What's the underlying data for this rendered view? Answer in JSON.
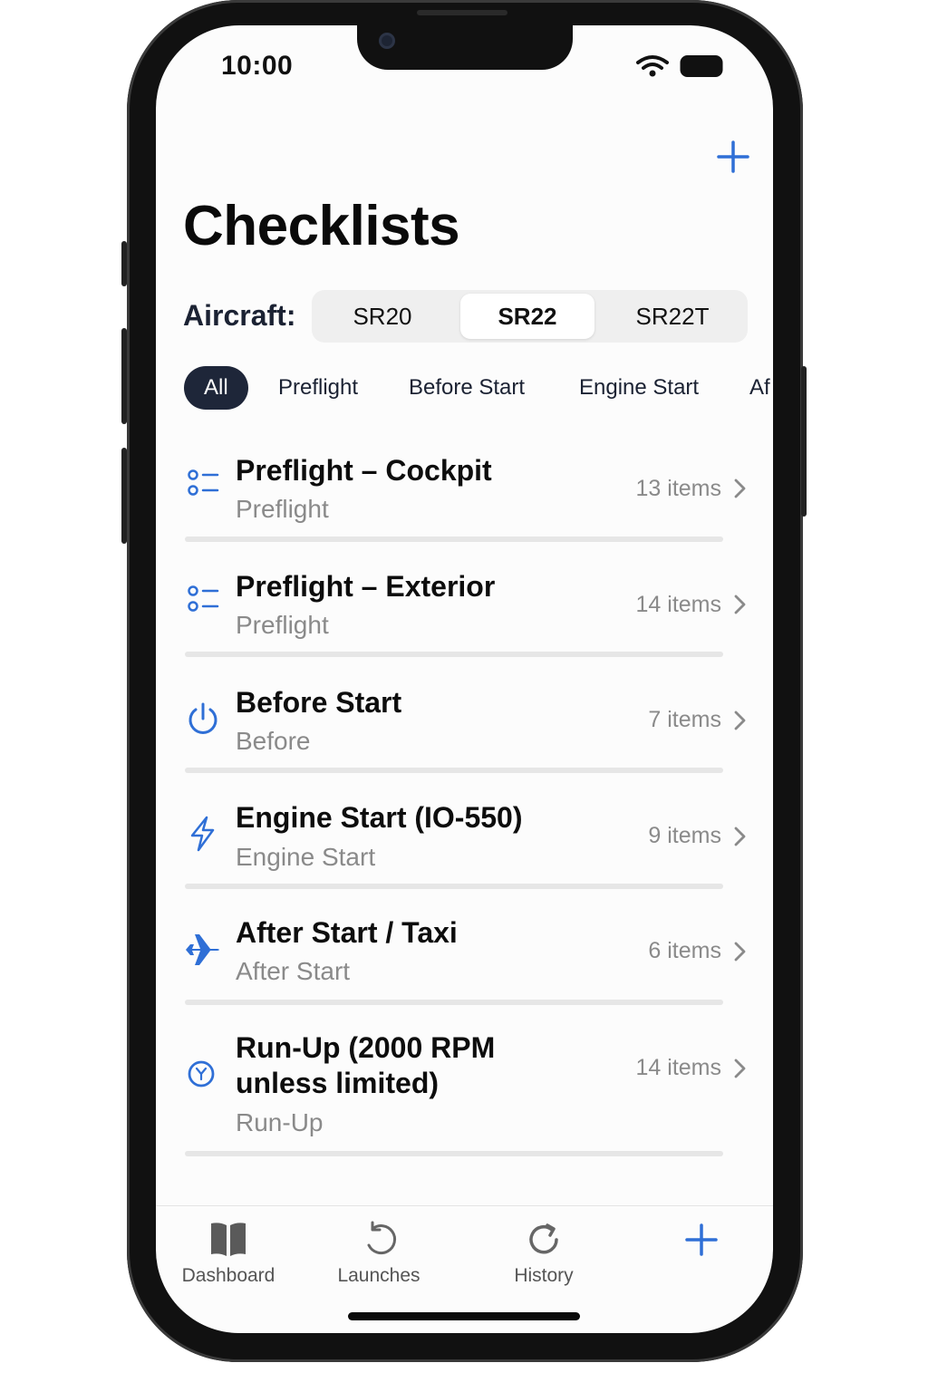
{
  "status": {
    "time": "10:00"
  },
  "header": {
    "title": "Checklists",
    "add_icon": "plus-icon"
  },
  "aircraft": {
    "label": "Aircraft:",
    "options": [
      "SR20",
      "SR22",
      "SR22T"
    ],
    "selected": "SR22"
  },
  "filters": {
    "chips": [
      "All",
      "Preflight",
      "Before Start",
      "Engine Start",
      "Af"
    ],
    "selected": "All"
  },
  "checklists": [
    {
      "title": "Preflight – Cockpit",
      "category": "Preflight",
      "count": "13 items",
      "icon": "checklist-icon"
    },
    {
      "title": "Preflight – Exterior",
      "category": "Preflight",
      "count": "14 items",
      "icon": "checklist-icon"
    },
    {
      "title": "Before Start",
      "category": "Before",
      "count": "7 items",
      "icon": "power-icon"
    },
    {
      "title": "Engine Start (IO-550)",
      "category": "Engine Start",
      "count": "9 items",
      "icon": "bolt-icon"
    },
    {
      "title": "After Start / Taxi",
      "category": "After Start",
      "count": "6 items",
      "icon": "airplane-icon"
    },
    {
      "title_line1": "Run-Up (2000 RPM",
      "title_line2": "unless limited)",
      "category": "Run-Up",
      "count": "14 items",
      "icon": "timer-icon"
    }
  ],
  "tabbar": {
    "tabs": [
      {
        "label": "Dashboard",
        "icon": "book-icon"
      },
      {
        "label": "Launches",
        "icon": "refresh-icon"
      },
      {
        "label": "History",
        "icon": "history-icon"
      },
      {
        "label": "",
        "icon": "plus-icon"
      }
    ]
  },
  "colors": {
    "accent": "#2f6fd6",
    "chip_active": "#1e2639",
    "muted": "#8a8a8a"
  }
}
